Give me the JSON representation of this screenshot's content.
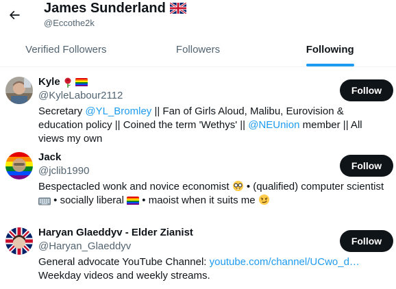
{
  "header": {
    "back_label": "Back",
    "name": "James Sunderland",
    "handle": "@Eccothe2k"
  },
  "tabs": [
    {
      "label": "Verified Followers",
      "active": false
    },
    {
      "label": "Followers",
      "active": false
    },
    {
      "label": "Following",
      "active": true
    }
  ],
  "users": [
    {
      "name": "Kyle",
      "name_icons": [
        "rose-icon",
        "pride-flag-icon"
      ],
      "handle": "@KyleLabour2112",
      "button": "Follow",
      "bio": {
        "p1": "Secretary ",
        "link1": "@YL_Bromley",
        "p2": " || Fan of Girls Aloud, Malibu, Eurovision & education policy || Coined the term 'Wethys' || ",
        "link2": "@NEUnion",
        "p3": " member || All views my own"
      }
    },
    {
      "name": "Jack",
      "handle": "@jclib1990",
      "button": "Follow",
      "bio": {
        "p1": "Bespectacled wonk and novice economist ",
        "p2": " • (qualified) computer scientist ",
        "p3": " • socially liberal ",
        "p4": " • maoist when it suits me "
      },
      "bio_icons": [
        "nerd-face-icon",
        "keyboard-icon",
        "pride-flag-icon",
        "smirk-face-icon"
      ]
    },
    {
      "name": "Haryan Glaeddyv - Elder Zianist",
      "handle": "@Haryan_Glaeddyv",
      "button": "Follow",
      "bio": {
        "p1": "General advocate YouTube Channel: ",
        "link1": "youtube.com/channel/UCwo_d…",
        "p2": "Weekday videos and weekly streams."
      }
    }
  ],
  "colors": {
    "accent": "#1d9bf0",
    "text": "#0f1419",
    "muted": "#536471",
    "button_bg": "#0f1419"
  }
}
